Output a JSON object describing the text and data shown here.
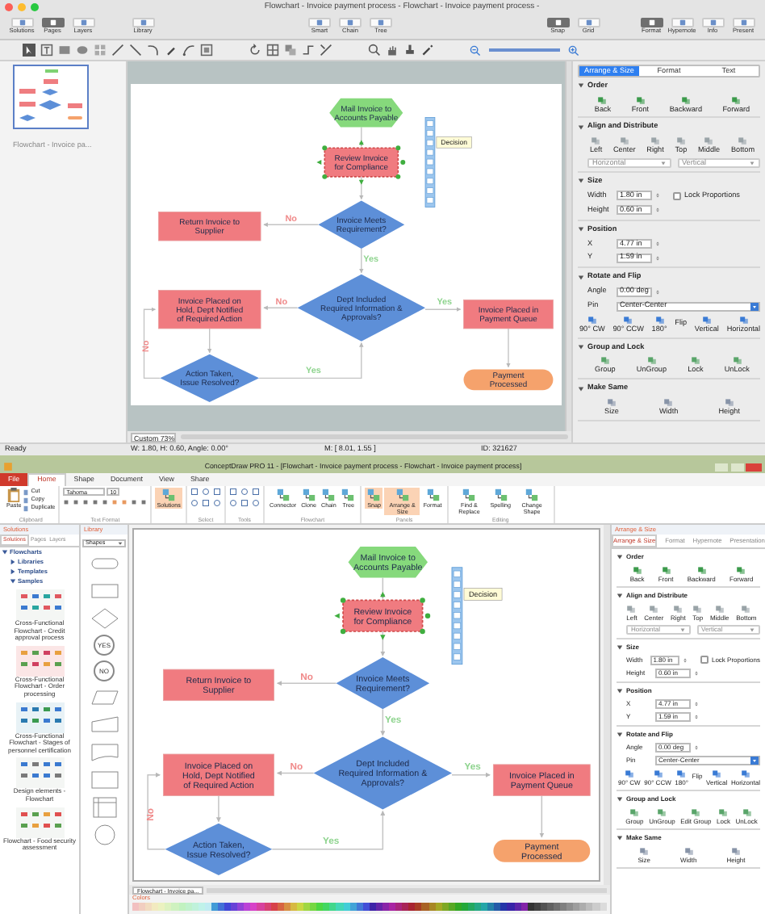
{
  "mac": {
    "title": "Flowchart - Invoice payment process - Flowchart - Invoice payment process -",
    "toolbar": [
      {
        "label": "Solutions",
        "selected": false
      },
      {
        "label": "Pages",
        "selected": true
      },
      {
        "label": "Layers",
        "selected": false
      },
      {
        "label": "Library",
        "selected": false
      },
      {
        "label": "Smart",
        "selected": false
      },
      {
        "label": "Chain",
        "selected": false
      },
      {
        "label": "Tree",
        "selected": false
      },
      {
        "label": "Snap",
        "selected": true
      },
      {
        "label": "Grid",
        "selected": false
      },
      {
        "label": "Format",
        "selected": true
      },
      {
        "label": "Hypernote",
        "selected": false
      },
      {
        "label": "Info",
        "selected": false
      },
      {
        "label": "Present",
        "selected": false
      }
    ],
    "page_caption": "Flowchart - Invoice pa...",
    "flowchart": {
      "nodes": [
        {
          "kind": "hexagon",
          "lines": [
            "Mail Invoice to",
            "Accounts Payable"
          ],
          "selected": false
        },
        {
          "kind": "process",
          "lines": [
            "Review Invoice",
            "for Compliance"
          ],
          "selected": true
        },
        {
          "kind": "process",
          "lines": [
            "Return Invoice to",
            "Supplier"
          ],
          "selected": false
        },
        {
          "kind": "decision",
          "lines": [
            "Invoice Meets",
            "Requirement?"
          ],
          "selected": false
        },
        {
          "kind": "process",
          "lines": [
            "Invoice Placed on",
            "Hold, Dept Notified",
            "of Required Action"
          ],
          "selected": false
        },
        {
          "kind": "decision",
          "lines": [
            "Dept Included",
            "Required Information &",
            "Approvals?"
          ],
          "selected": false
        },
        {
          "kind": "process",
          "lines": [
            "Invoice Placed in",
            "Payment Queue"
          ],
          "selected": false
        },
        {
          "kind": "decision",
          "lines": [
            "Action Taken,",
            "Issue Resolved?"
          ],
          "selected": false
        },
        {
          "kind": "rounded",
          "lines": [
            "Payment",
            "Processed"
          ],
          "selected": false
        }
      ],
      "edge_labels": [
        {
          "text": "No",
          "color": "#f08a8a"
        },
        {
          "text": "Yes",
          "color": "#8fd48f"
        },
        {
          "text": "No",
          "color": "#f08a8a"
        },
        {
          "text": "Yes",
          "color": "#8fd48f"
        },
        {
          "text": "Yes",
          "color": "#8fd48f"
        },
        {
          "text": "No",
          "color": "#f08a8a"
        }
      ],
      "tooltip": "Decision"
    },
    "zoom": "Custom 73%",
    "status": {
      "state": "Ready",
      "dimensions": "W: 1.80, H: 0.60, Angle: 0.00°",
      "mouse": "M: [ 8.01, 1.55 ]",
      "id": "ID: 321627"
    },
    "inspector": {
      "tabs": [
        {
          "label": "Arrange & Size",
          "selected": true
        },
        {
          "label": "Format",
          "selected": false
        },
        {
          "label": "Text",
          "selected": false
        }
      ],
      "sections": [
        {
          "title": "Order",
          "rows": [
            {
              "kind": "buttons",
              "labels": [
                "Back",
                "Front",
                "Backward",
                "Forward"
              ]
            }
          ]
        },
        {
          "title": "Align and Distribute",
          "rows": [
            {
              "kind": "buttons",
              "labels": [
                "Left",
                "Center",
                "Right",
                "Top",
                "Middle",
                "Bottom"
              ]
            },
            {
              "kind": "dropdowns",
              "values": [
                "Horizontal",
                "Vertical"
              ],
              "disabled": true
            }
          ]
        },
        {
          "title": "Size",
          "rows": [
            {
              "kind": "field",
              "label": "Width",
              "value": "1.80 in",
              "checkbox": {
                "label": "Lock Proportions",
                "checked": false
              }
            },
            {
              "kind": "field",
              "label": "Height",
              "value": "0.60 in"
            }
          ]
        },
        {
          "title": "Position",
          "rows": [
            {
              "kind": "field",
              "label": "X",
              "value": "4.77 in"
            },
            {
              "kind": "field",
              "label": "Y",
              "value": "1.59 in"
            }
          ]
        },
        {
          "title": "Rotate and Flip",
          "rows": [
            {
              "kind": "field",
              "label": "Angle",
              "value": "0.00 deg"
            },
            {
              "kind": "select",
              "label": "Pin",
              "value": "Center-Center"
            },
            {
              "kind": "flip",
              "rotate": [
                "90° CW",
                "90° CCW",
                "180°"
              ],
              "caption": "Flip",
              "flip": [
                "Vertical",
                "Horizontal"
              ]
            }
          ]
        },
        {
          "title": "Group and Lock",
          "rows": [
            {
              "kind": "buttons",
              "labels": [
                "Group",
                "UnGroup",
                "Lock",
                "UnLock"
              ]
            }
          ]
        },
        {
          "title": "Make Same",
          "rows": [
            {
              "kind": "buttons",
              "labels": [
                "Size",
                "Width",
                "Height"
              ]
            }
          ]
        }
      ]
    }
  },
  "win": {
    "title": "ConceptDraw PRO 11 - [Flowchart - Invoice payment process - Flowchart - Invoice payment process]",
    "file_tab": "File",
    "ribbon_tabs": [
      {
        "label": "Home",
        "selected": true
      },
      {
        "label": "Shape",
        "selected": false
      },
      {
        "label": "Document",
        "selected": false
      },
      {
        "label": "View",
        "selected": false
      },
      {
        "label": "Share",
        "selected": false
      }
    ],
    "ribbon_groups": [
      {
        "kind": "clipboard",
        "label": "Clipboard",
        "big": "Paste",
        "small": [
          "Cut",
          "Copy",
          "Duplicate"
        ]
      },
      {
        "kind": "text_format",
        "label": "Text Format",
        "font": "Tahoma",
        "size": "10"
      },
      {
        "kind": "big",
        "buttons": [
          {
            "label": "Solutions",
            "selected": true
          }
        ]
      },
      {
        "kind": "icons",
        "label": "Select"
      },
      {
        "kind": "icons",
        "label": "Tools"
      },
      {
        "kind": "big",
        "label": "Flowchart",
        "buttons": [
          {
            "label": "Connector",
            "selected": false
          },
          {
            "label": "Clone",
            "selected": false
          },
          {
            "label": "Chain",
            "selected": false
          },
          {
            "label": "Tree",
            "selected": false
          }
        ]
      },
      {
        "kind": "big",
        "label": "Panels",
        "buttons": [
          {
            "label": "Snap",
            "selected": true
          },
          {
            "label": "Arrange & Size",
            "selected": true
          },
          {
            "label": "Format",
            "selected": false
          }
        ]
      },
      {
        "kind": "big",
        "label": "Editing",
        "buttons": [
          {
            "label": "Find & Replace",
            "selected": false
          },
          {
            "label": "Spelling",
            "selected": false
          },
          {
            "label": "Change Shape",
            "selected": false
          }
        ]
      }
    ],
    "solutions_panel": {
      "title": "Solutions",
      "tabs": [
        {
          "label": "Solutions",
          "selected": true
        },
        {
          "label": "Pages",
          "selected": false
        },
        {
          "label": "Layers",
          "selected": false
        }
      ],
      "tree": [
        {
          "label": "Flowcharts",
          "expanded": true,
          "children": [
            {
              "label": "Libraries",
              "expanded": false
            },
            {
              "label": "Templates",
              "expanded": false
            },
            {
              "label": "Samples",
              "expanded": true
            }
          ]
        }
      ],
      "samples": [
        {
          "caption": "Cross-Functional Flowchart - Credit approval process"
        },
        {
          "caption": "Cross-Functional Flowchart - Order processing"
        },
        {
          "caption": "Cross-Functional Flowchart - Stages of personnel certification"
        },
        {
          "caption": "Design elements - Flowchart"
        },
        {
          "caption": "Flowchart - Food security assessment"
        }
      ]
    },
    "library_panel": {
      "title": "Library",
      "dropdown": "Shapes",
      "yes": "YES",
      "no": "NO"
    },
    "flowchart": {
      "nodes": [
        {
          "kind": "hexagon",
          "lines": [
            "Mail Invoice to",
            "Accounts Payable"
          ],
          "selected": false
        },
        {
          "kind": "process",
          "lines": [
            "Review Invoice",
            "for Compliance"
          ],
          "selected": true
        },
        {
          "kind": "process",
          "lines": [
            "Return Invoice to",
            "Supplier"
          ],
          "selected": false
        },
        {
          "kind": "decision",
          "lines": [
            "Invoice Meets",
            "Requirement?"
          ],
          "selected": false
        },
        {
          "kind": "process",
          "lines": [
            "Invoice Placed on",
            "Hold, Dept Notified",
            "of Required Action"
          ],
          "selected": false
        },
        {
          "kind": "decision",
          "lines": [
            "Dept Included",
            "Required Information &",
            "Approvals?"
          ],
          "selected": false
        },
        {
          "kind": "process",
          "lines": [
            "Invoice Placed in",
            "Payment Queue"
          ],
          "selected": false
        },
        {
          "kind": "decision",
          "lines": [
            "Action Taken,",
            "Issue Resolved?"
          ],
          "selected": false
        },
        {
          "kind": "rounded",
          "lines": [
            "Payment",
            "Processed"
          ],
          "selected": false
        }
      ],
      "edge_labels": [
        {
          "text": "No",
          "color": "#f08a8a"
        },
        {
          "text": "Yes",
          "color": "#8fd48f"
        },
        {
          "text": "No",
          "color": "#f08a8a"
        },
        {
          "text": "Yes",
          "color": "#8fd48f"
        },
        {
          "text": "Yes",
          "color": "#8fd48f"
        },
        {
          "text": "No",
          "color": "#f08a8a"
        }
      ],
      "tooltip": "Decision"
    },
    "page_tab": "Flowchart - Invoice pa...",
    "colors_label": "Colors",
    "inspector": {
      "title": "Arrange & Size",
      "tabs": [
        {
          "label": "Arrange & Size",
          "selected": true
        },
        {
          "label": "Format",
          "selected": false
        },
        {
          "label": "Hypernote",
          "selected": false
        },
        {
          "label": "Presentation",
          "selected": false
        }
      ],
      "sections": [
        {
          "title": "Order",
          "rows": [
            {
              "kind": "buttons",
              "labels": [
                "Back",
                "Front",
                "Backward",
                "Forward"
              ]
            }
          ]
        },
        {
          "title": "Align and Distribute",
          "rows": [
            {
              "kind": "buttons",
              "labels": [
                "Left",
                "Center",
                "Right",
                "Top",
                "Middle",
                "Bottom"
              ]
            },
            {
              "kind": "dropdowns",
              "values": [
                "Horizontal",
                "Vertical"
              ],
              "disabled": true
            }
          ]
        },
        {
          "title": "Size",
          "rows": [
            {
              "kind": "field",
              "label": "Width",
              "value": "1.80 in",
              "checkbox": {
                "label": "Lock Proportions",
                "checked": false
              }
            },
            {
              "kind": "field",
              "label": "Height",
              "value": "0.60 in"
            }
          ]
        },
        {
          "title": "Position",
          "rows": [
            {
              "kind": "field",
              "label": "X",
              "value": "4.77 in"
            },
            {
              "kind": "field",
              "label": "Y",
              "value": "1.59 in"
            }
          ]
        },
        {
          "title": "Rotate and Flip",
          "rows": [
            {
              "kind": "field",
              "label": "Angle",
              "value": "0.00 deg"
            },
            {
              "kind": "select",
              "label": "Pin",
              "value": "Center-Center"
            },
            {
              "kind": "flip",
              "rotate": [
                "90° CW",
                "90° CCW",
                "180°"
              ],
              "caption": "Flip",
              "flip": [
                "Vertical",
                "Horizontal"
              ]
            }
          ]
        },
        {
          "title": "Group and Lock",
          "rows": [
            {
              "kind": "buttons",
              "labels": [
                "Group",
                "UnGroup",
                "Edit Group",
                "Lock",
                "UnLock"
              ]
            }
          ]
        },
        {
          "title": "Make Same",
          "rows": [
            {
              "kind": "buttons",
              "labels": [
                "Size",
                "Width",
                "Height"
              ]
            }
          ]
        }
      ]
    }
  }
}
